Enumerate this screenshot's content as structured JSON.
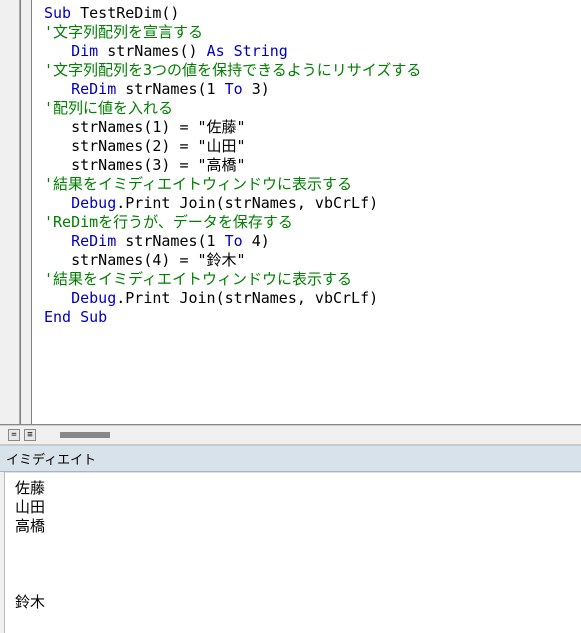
{
  "code": {
    "lines": [
      {
        "indent": 0,
        "segments": [
          {
            "t": "Sub",
            "c": "kw"
          },
          {
            "t": " TestReDim()",
            "c": "tk"
          }
        ]
      },
      {
        "indent": 0,
        "segments": [
          {
            "t": "'文字列配列を宣言する",
            "c": "cm"
          }
        ]
      },
      {
        "indent": 1,
        "segments": [
          {
            "t": "Dim",
            "c": "kw"
          },
          {
            "t": " strNames() ",
            "c": "tk"
          },
          {
            "t": "As String",
            "c": "kw"
          }
        ]
      },
      {
        "indent": 0,
        "segments": [
          {
            "t": "'文字列配列を3つの値を保持できるようにリサイズする",
            "c": "cm"
          }
        ]
      },
      {
        "indent": 1,
        "segments": [
          {
            "t": "ReDim",
            "c": "kw"
          },
          {
            "t": " strNames(1 ",
            "c": "tk"
          },
          {
            "t": "To",
            "c": "kw"
          },
          {
            "t": " 3)",
            "c": "tk"
          }
        ]
      },
      {
        "indent": 0,
        "segments": [
          {
            "t": "'配列に値を入れる",
            "c": "cm"
          }
        ]
      },
      {
        "indent": 1,
        "segments": [
          {
            "t": "strNames(1) = \"佐藤\"",
            "c": "tk"
          }
        ]
      },
      {
        "indent": 1,
        "segments": [
          {
            "t": "strNames(2) = \"山田\"",
            "c": "tk"
          }
        ]
      },
      {
        "indent": 1,
        "segments": [
          {
            "t": "strNames(3) = \"高橋\"",
            "c": "tk"
          }
        ]
      },
      {
        "indent": 0,
        "segments": [
          {
            "t": "'結果をイミディエイトウィンドウに表示する",
            "c": "cm"
          }
        ]
      },
      {
        "indent": 1,
        "segments": [
          {
            "t": "Debug",
            "c": "kw"
          },
          {
            "t": ".Print Join(strNames, vbCrLf)",
            "c": "tk"
          }
        ]
      },
      {
        "indent": 0,
        "segments": [
          {
            "t": "'ReDimを行うが、データを保存する",
            "c": "cm"
          }
        ]
      },
      {
        "indent": 1,
        "segments": [
          {
            "t": "ReDim",
            "c": "kw"
          },
          {
            "t": " strNames(1 ",
            "c": "tk"
          },
          {
            "t": "To",
            "c": "kw"
          },
          {
            "t": " 4)",
            "c": "tk"
          }
        ]
      },
      {
        "indent": 1,
        "segments": [
          {
            "t": "strNames(4) = \"鈴木\"",
            "c": "tk"
          }
        ]
      },
      {
        "indent": 0,
        "segments": [
          {
            "t": "'結果をイミディエイトウィンドウに表示する",
            "c": "cm"
          }
        ]
      },
      {
        "indent": 1,
        "segments": [
          {
            "t": "Debug",
            "c": "kw"
          },
          {
            "t": ".Print Join(strNames, vbCrLf)",
            "c": "tk"
          }
        ]
      },
      {
        "indent": 0,
        "segments": [
          {
            "t": "End Sub",
            "c": "kw"
          }
        ]
      }
    ]
  },
  "splitter": {
    "btn1": "=",
    "btn2": "≡"
  },
  "immediate": {
    "title": "イミディエイト",
    "output": "佐藤\n山田\n高橋\n\n\n\n鈴木"
  }
}
